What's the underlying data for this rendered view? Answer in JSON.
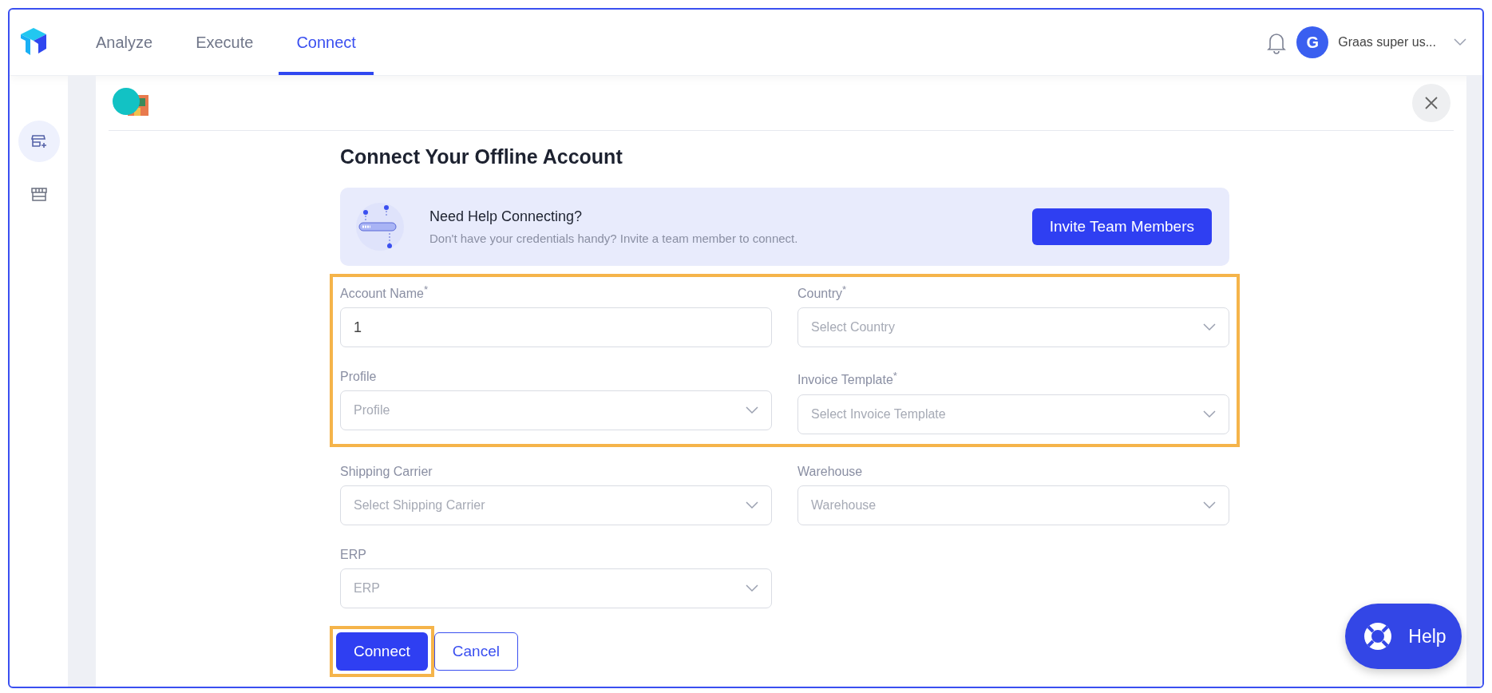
{
  "nav": {
    "tabs": [
      {
        "label": "Analyze",
        "selected": false
      },
      {
        "label": "Execute",
        "selected": false
      },
      {
        "label": "Connect",
        "selected": true
      }
    ],
    "user": {
      "initial": "G",
      "name": "Graas super us..."
    }
  },
  "sidebar": {
    "items": [
      {
        "selected": true,
        "kind": "store-add"
      },
      {
        "selected": false,
        "kind": "store"
      }
    ]
  },
  "title": "Connect Your Offline Account",
  "help_banner": {
    "heading": "Need Help Connecting?",
    "text": "Don't have your credentials handy? Invite a team member to connect.",
    "button": "Invite Team Members"
  },
  "field_groups": [
    {
      "highlighted": true,
      "fields": [
        {
          "label": "Account Name$^{*}$",
          "kind": "text",
          "value": "1"
        },
        {
          "label": "Country$^{*}$",
          "kind": "select",
          "placeholder": "Select Country"
        },
        {
          "label": "Profile",
          "kind": "select",
          "placeholder": "Profile"
        },
        {
          "label": "Invoice Template$^{*}$",
          "kind": "select",
          "placeholder": "Select Invoice Template"
        }
      ]
    },
    {
      "highlighted": false,
      "fields": [
        {
          "label": "Shipping Carrier",
          "kind": "select",
          "placeholder": "Select Shipping Carrier"
        },
        {
          "label": "Warehouse",
          "kind": "select",
          "placeholder": "Warehouse"
        },
        {
          "label": "ERP",
          "kind": "select",
          "placeholder": "ERP"
        }
      ]
    }
  ],
  "buttons": [
    {
      "label": "Connect",
      "kind": "primary",
      "highlighted": true
    },
    {
      "label": "Cancel",
      "kind": "outline",
      "highlighted": false
    }
  ],
  "help_button": {
    "label": "Help"
  }
}
